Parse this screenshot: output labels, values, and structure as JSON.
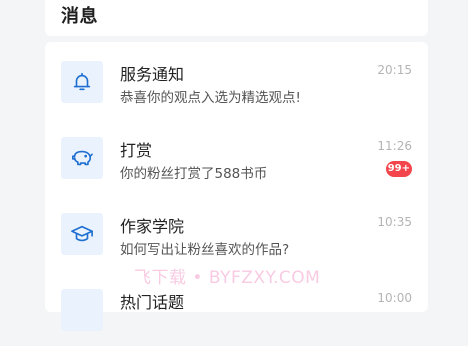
{
  "header": {
    "title": "消息"
  },
  "messages": [
    {
      "title": "服务通知",
      "subtitle": "恭喜你的观点入选为精选观点!",
      "time": "20:15",
      "icon": "bell-icon"
    },
    {
      "title": "打赏",
      "subtitle": "你的粉丝打赏了588书币",
      "time": "11:26",
      "badge": "99+",
      "icon": "piggy-bank-icon"
    },
    {
      "title": "作家学院",
      "subtitle": "如何写出让粉丝喜欢的作品?",
      "time": "10:35",
      "icon": "graduation-cap-icon"
    },
    {
      "title": "热门话题",
      "time": "10:00",
      "icon": "hot-topic-icon"
    }
  ],
  "watermark": "飞下载 • BYFZXY.COM",
  "colors": {
    "accent": "#1f6fd1",
    "icon_bg": "#eaf3fd",
    "badge": "#f2454c"
  }
}
